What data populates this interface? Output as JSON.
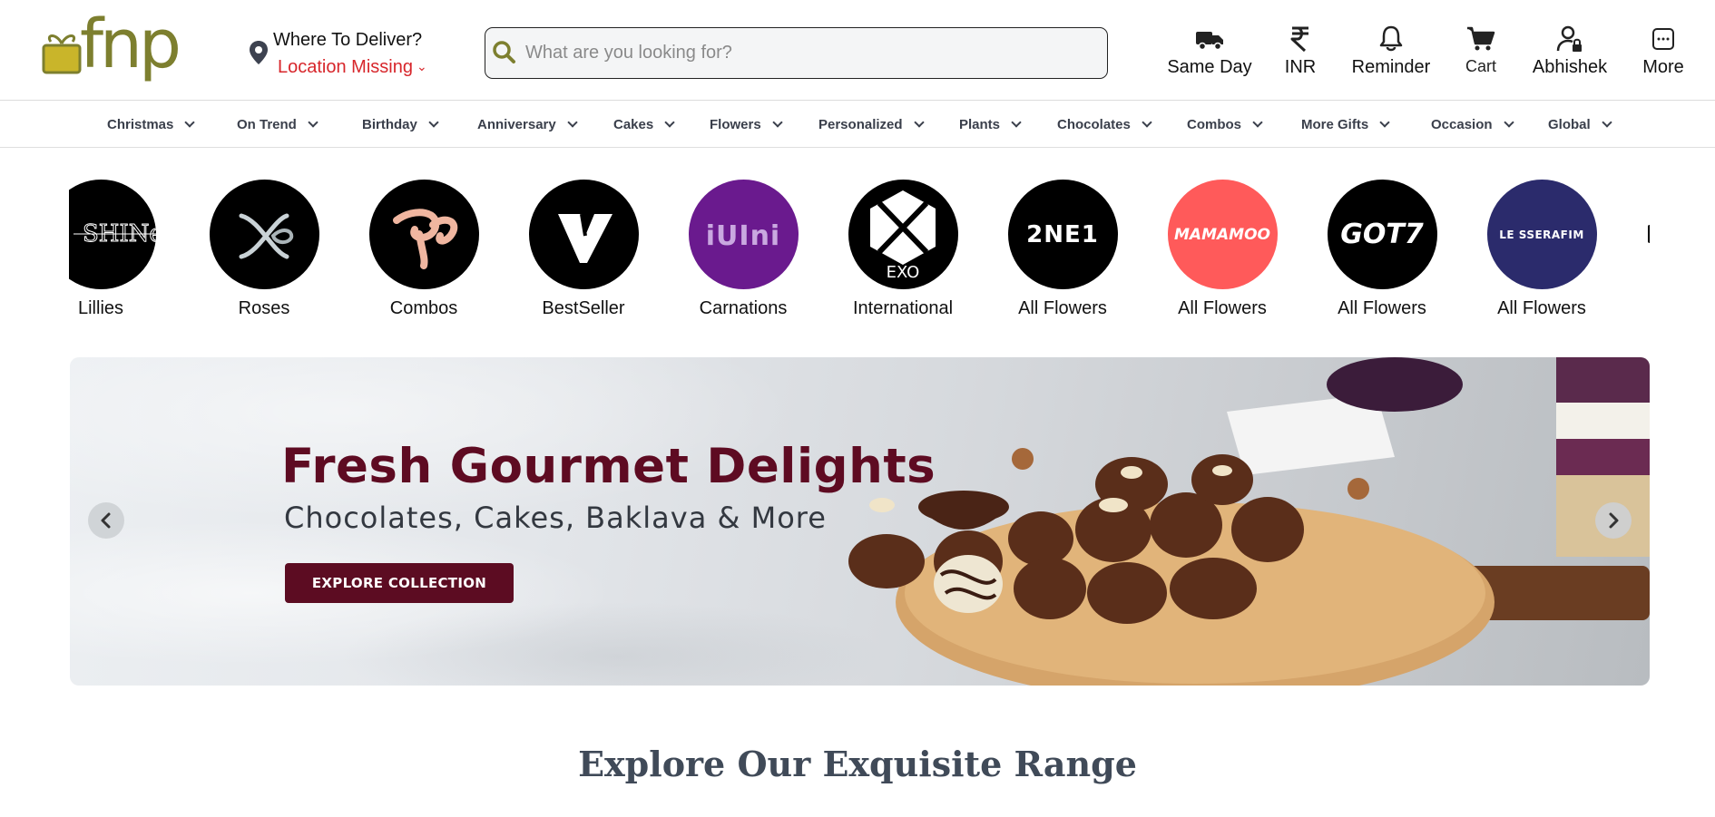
{
  "header": {
    "logo_text": "fnp",
    "deliver_title": "Where To Deliver?",
    "deliver_location": "Location Missing",
    "search_placeholder": "What are you looking for?",
    "icons": [
      {
        "icon": "truck-icon",
        "label": "Same Day"
      },
      {
        "icon": "rupee-icon",
        "label": "INR"
      },
      {
        "icon": "bell-icon",
        "label": "Reminder"
      },
      {
        "icon": "cart-icon",
        "label": "Cart"
      },
      {
        "icon": "user-icon",
        "label": "Abhishek"
      },
      {
        "icon": "more-icon",
        "label": "More"
      }
    ]
  },
  "nav": {
    "items": [
      "Christmas",
      "On Trend",
      "Birthday",
      "Anniversary",
      "Cakes",
      "Flowers",
      "Personalized",
      "Plants",
      "Chocolates",
      "Combos",
      "More Gifts",
      "Occasion",
      "Global"
    ]
  },
  "categories": [
    {
      "name": "Lillies",
      "logo": "SHINee"
    },
    {
      "name": "Roses",
      "logo": ""
    },
    {
      "name": "Combos",
      "logo": ""
    },
    {
      "name": "BestSeller",
      "logo": ""
    },
    {
      "name": "Carnations",
      "logo": "iUIni"
    },
    {
      "name": "International",
      "logo": "EXO"
    },
    {
      "name": "All Flowers",
      "logo": "2NE1"
    },
    {
      "name": "All Flowers",
      "logo": "MAMAMOO"
    },
    {
      "name": "All Flowers",
      "logo": "GOT7"
    },
    {
      "name": "All Flowers",
      "logo": "LE SSERAFIM"
    }
  ],
  "banner": {
    "headline": "Fresh Gourmet Delights",
    "subline": "Chocolates, Cakes, Baklava & More",
    "cta": "EXPLORE COLLECTION"
  },
  "section_title": "Explore Our Exquisite Range",
  "colors": {
    "brand_olive": "#7d7f2f",
    "brand_gold": "#c9b52a",
    "location_red": "#d7262b",
    "maroon": "#5e0b22"
  }
}
